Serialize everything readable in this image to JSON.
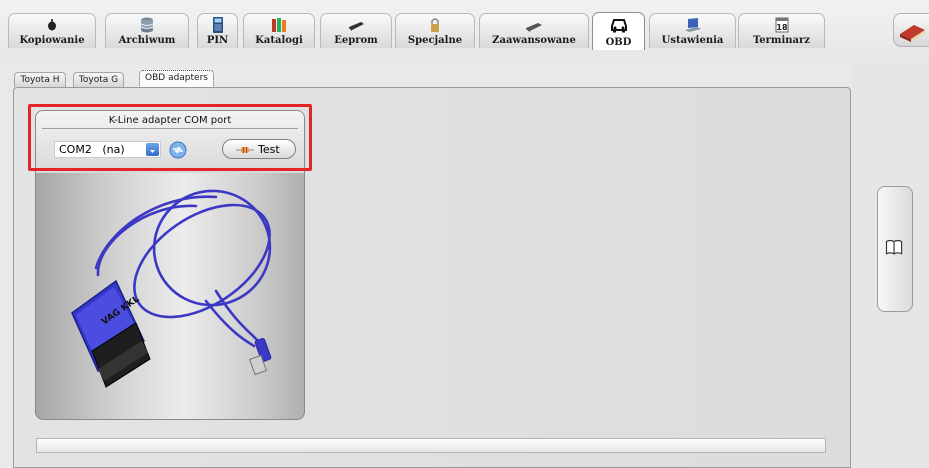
{
  "top_tabs": [
    {
      "label": "Kopiowanie",
      "icon": "key-icon"
    },
    {
      "label": "Archiwum",
      "icon": "database-icon"
    },
    {
      "label": "PIN",
      "icon": "calculator-icon"
    },
    {
      "label": "Katalogi",
      "icon": "books-icon"
    },
    {
      "label": "Eeprom",
      "icon": "chip-icon"
    },
    {
      "label": "Specjalne",
      "icon": "padlock-icon"
    },
    {
      "label": "Zaawansowane",
      "icon": "device-icon"
    },
    {
      "label": "OBD",
      "icon": "car-icon",
      "active": true
    },
    {
      "label": "Ustawienia",
      "icon": "laptop-icon"
    },
    {
      "label": "Terminarz",
      "icon": "calendar-icon"
    }
  ],
  "calendar_day": "18",
  "sub_tabs": [
    {
      "label": "Toyota H"
    },
    {
      "label": "Toyota G"
    },
    {
      "label": "OBD adapters",
      "active": true
    }
  ],
  "adapter_panel": {
    "title": "K-Line adapter COM port",
    "com_port": "COM2   (na)",
    "test_label": "Test",
    "cable_brand": "VAG KKL"
  },
  "colors": {
    "highlight": "#e02626",
    "select_arrow": "#2f6fc8",
    "cable": "#3b38c4"
  }
}
